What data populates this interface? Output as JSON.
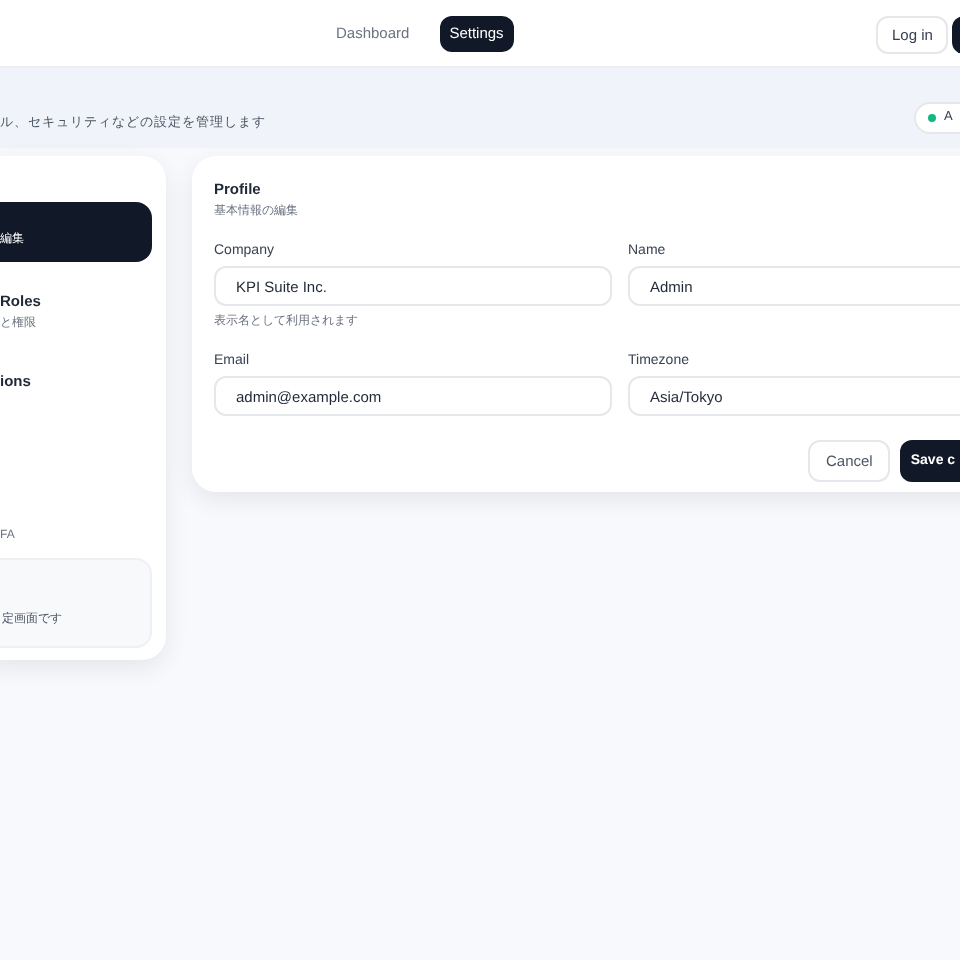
{
  "nav": [
    {
      "label": "Dashboard",
      "selected": false
    },
    {
      "label": "Settings",
      "selected": true
    }
  ],
  "header_buttons": {
    "login": "Log in"
  },
  "page": {
    "subtitle": "ル、セキュリティなどの設定を管理します",
    "badge": "A"
  },
  "sidebar": {
    "items": [
      {
        "subtitle": "編集",
        "selected": true
      },
      {
        "title": "Roles",
        "subtitle": "と権限",
        "selected": false
      },
      {
        "title": "ions",
        "selected": false
      },
      {
        "subtitle": "FA",
        "selected": false
      }
    ],
    "note": "定画面です"
  },
  "profile": {
    "title": "Profile",
    "subtitle": "基本情報の編集",
    "fields": [
      {
        "label": "Company",
        "value": "KPI Suite Inc.",
        "help": "表示名として利用されます"
      },
      {
        "label": "Name",
        "value": "Admin"
      },
      {
        "label": "Email",
        "value": "admin@example.com"
      },
      {
        "label": "Timezone",
        "value": "Asia/Tokyo"
      }
    ],
    "buttons": {
      "cancel": "Cancel",
      "save": "Save c"
    }
  }
}
